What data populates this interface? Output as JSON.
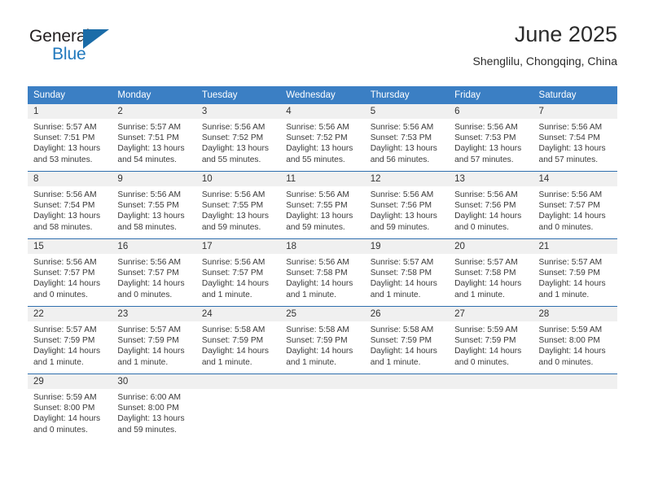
{
  "logo": {
    "primary_text": "General",
    "secondary_text": "Blue",
    "triangle_icon": "blue-triangle-icon",
    "primary_color": "#231f20",
    "secondary_color": "#2179bd"
  },
  "header": {
    "title": "June 2025",
    "subtitle": "Shenglilu, Chongqing, China"
  },
  "theme": {
    "header_bg": "#3b7fc4",
    "header_text": "#ffffff",
    "daynum_bg": "#f0f0f0",
    "row_border": "#2f6fae",
    "body_text": "#3a3a3a"
  },
  "calendar": {
    "weekday_headers": [
      "Sunday",
      "Monday",
      "Tuesday",
      "Wednesday",
      "Thursday",
      "Friday",
      "Saturday"
    ],
    "weeks": [
      [
        {
          "day": "1",
          "sunrise": "Sunrise: 5:57 AM",
          "sunset": "Sunset: 7:51 PM",
          "daylight_line1": "Daylight: 13 hours",
          "daylight_line2": "and 53 minutes."
        },
        {
          "day": "2",
          "sunrise": "Sunrise: 5:57 AM",
          "sunset": "Sunset: 7:51 PM",
          "daylight_line1": "Daylight: 13 hours",
          "daylight_line2": "and 54 minutes."
        },
        {
          "day": "3",
          "sunrise": "Sunrise: 5:56 AM",
          "sunset": "Sunset: 7:52 PM",
          "daylight_line1": "Daylight: 13 hours",
          "daylight_line2": "and 55 minutes."
        },
        {
          "day": "4",
          "sunrise": "Sunrise: 5:56 AM",
          "sunset": "Sunset: 7:52 PM",
          "daylight_line1": "Daylight: 13 hours",
          "daylight_line2": "and 55 minutes."
        },
        {
          "day": "5",
          "sunrise": "Sunrise: 5:56 AM",
          "sunset": "Sunset: 7:53 PM",
          "daylight_line1": "Daylight: 13 hours",
          "daylight_line2": "and 56 minutes."
        },
        {
          "day": "6",
          "sunrise": "Sunrise: 5:56 AM",
          "sunset": "Sunset: 7:53 PM",
          "daylight_line1": "Daylight: 13 hours",
          "daylight_line2": "and 57 minutes."
        },
        {
          "day": "7",
          "sunrise": "Sunrise: 5:56 AM",
          "sunset": "Sunset: 7:54 PM",
          "daylight_line1": "Daylight: 13 hours",
          "daylight_line2": "and 57 minutes."
        }
      ],
      [
        {
          "day": "8",
          "sunrise": "Sunrise: 5:56 AM",
          "sunset": "Sunset: 7:54 PM",
          "daylight_line1": "Daylight: 13 hours",
          "daylight_line2": "and 58 minutes."
        },
        {
          "day": "9",
          "sunrise": "Sunrise: 5:56 AM",
          "sunset": "Sunset: 7:55 PM",
          "daylight_line1": "Daylight: 13 hours",
          "daylight_line2": "and 58 minutes."
        },
        {
          "day": "10",
          "sunrise": "Sunrise: 5:56 AM",
          "sunset": "Sunset: 7:55 PM",
          "daylight_line1": "Daylight: 13 hours",
          "daylight_line2": "and 59 minutes."
        },
        {
          "day": "11",
          "sunrise": "Sunrise: 5:56 AM",
          "sunset": "Sunset: 7:55 PM",
          "daylight_line1": "Daylight: 13 hours",
          "daylight_line2": "and 59 minutes."
        },
        {
          "day": "12",
          "sunrise": "Sunrise: 5:56 AM",
          "sunset": "Sunset: 7:56 PM",
          "daylight_line1": "Daylight: 13 hours",
          "daylight_line2": "and 59 minutes."
        },
        {
          "day": "13",
          "sunrise": "Sunrise: 5:56 AM",
          "sunset": "Sunset: 7:56 PM",
          "daylight_line1": "Daylight: 14 hours",
          "daylight_line2": "and 0 minutes."
        },
        {
          "day": "14",
          "sunrise": "Sunrise: 5:56 AM",
          "sunset": "Sunset: 7:57 PM",
          "daylight_line1": "Daylight: 14 hours",
          "daylight_line2": "and 0 minutes."
        }
      ],
      [
        {
          "day": "15",
          "sunrise": "Sunrise: 5:56 AM",
          "sunset": "Sunset: 7:57 PM",
          "daylight_line1": "Daylight: 14 hours",
          "daylight_line2": "and 0 minutes."
        },
        {
          "day": "16",
          "sunrise": "Sunrise: 5:56 AM",
          "sunset": "Sunset: 7:57 PM",
          "daylight_line1": "Daylight: 14 hours",
          "daylight_line2": "and 0 minutes."
        },
        {
          "day": "17",
          "sunrise": "Sunrise: 5:56 AM",
          "sunset": "Sunset: 7:57 PM",
          "daylight_line1": "Daylight: 14 hours",
          "daylight_line2": "and 1 minute."
        },
        {
          "day": "18",
          "sunrise": "Sunrise: 5:56 AM",
          "sunset": "Sunset: 7:58 PM",
          "daylight_line1": "Daylight: 14 hours",
          "daylight_line2": "and 1 minute."
        },
        {
          "day": "19",
          "sunrise": "Sunrise: 5:57 AM",
          "sunset": "Sunset: 7:58 PM",
          "daylight_line1": "Daylight: 14 hours",
          "daylight_line2": "and 1 minute."
        },
        {
          "day": "20",
          "sunrise": "Sunrise: 5:57 AM",
          "sunset": "Sunset: 7:58 PM",
          "daylight_line1": "Daylight: 14 hours",
          "daylight_line2": "and 1 minute."
        },
        {
          "day": "21",
          "sunrise": "Sunrise: 5:57 AM",
          "sunset": "Sunset: 7:59 PM",
          "daylight_line1": "Daylight: 14 hours",
          "daylight_line2": "and 1 minute."
        }
      ],
      [
        {
          "day": "22",
          "sunrise": "Sunrise: 5:57 AM",
          "sunset": "Sunset: 7:59 PM",
          "daylight_line1": "Daylight: 14 hours",
          "daylight_line2": "and 1 minute."
        },
        {
          "day": "23",
          "sunrise": "Sunrise: 5:57 AM",
          "sunset": "Sunset: 7:59 PM",
          "daylight_line1": "Daylight: 14 hours",
          "daylight_line2": "and 1 minute."
        },
        {
          "day": "24",
          "sunrise": "Sunrise: 5:58 AM",
          "sunset": "Sunset: 7:59 PM",
          "daylight_line1": "Daylight: 14 hours",
          "daylight_line2": "and 1 minute."
        },
        {
          "day": "25",
          "sunrise": "Sunrise: 5:58 AM",
          "sunset": "Sunset: 7:59 PM",
          "daylight_line1": "Daylight: 14 hours",
          "daylight_line2": "and 1 minute."
        },
        {
          "day": "26",
          "sunrise": "Sunrise: 5:58 AM",
          "sunset": "Sunset: 7:59 PM",
          "daylight_line1": "Daylight: 14 hours",
          "daylight_line2": "and 1 minute."
        },
        {
          "day": "27",
          "sunrise": "Sunrise: 5:59 AM",
          "sunset": "Sunset: 7:59 PM",
          "daylight_line1": "Daylight: 14 hours",
          "daylight_line2": "and 0 minutes."
        },
        {
          "day": "28",
          "sunrise": "Sunrise: 5:59 AM",
          "sunset": "Sunset: 8:00 PM",
          "daylight_line1": "Daylight: 14 hours",
          "daylight_line2": "and 0 minutes."
        }
      ],
      [
        {
          "day": "29",
          "sunrise": "Sunrise: 5:59 AM",
          "sunset": "Sunset: 8:00 PM",
          "daylight_line1": "Daylight: 14 hours",
          "daylight_line2": "and 0 minutes."
        },
        {
          "day": "30",
          "sunrise": "Sunrise: 6:00 AM",
          "sunset": "Sunset: 8:00 PM",
          "daylight_line1": "Daylight: 13 hours",
          "daylight_line2": "and 59 minutes."
        },
        {
          "day": "",
          "sunrise": "",
          "sunset": "",
          "daylight_line1": "",
          "daylight_line2": ""
        },
        {
          "day": "",
          "sunrise": "",
          "sunset": "",
          "daylight_line1": "",
          "daylight_line2": ""
        },
        {
          "day": "",
          "sunrise": "",
          "sunset": "",
          "daylight_line1": "",
          "daylight_line2": ""
        },
        {
          "day": "",
          "sunrise": "",
          "sunset": "",
          "daylight_line1": "",
          "daylight_line2": ""
        },
        {
          "day": "",
          "sunrise": "",
          "sunset": "",
          "daylight_line1": "",
          "daylight_line2": ""
        }
      ]
    ]
  }
}
